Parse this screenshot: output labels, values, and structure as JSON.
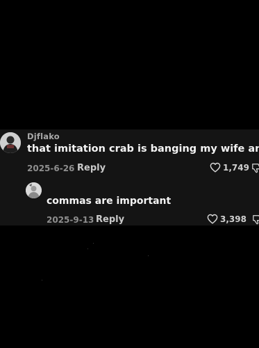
{
  "comment": {
    "username": "Djflako",
    "text": "that imitation crab is banging my wife and I love it",
    "date": "2025-6-26",
    "reply_label": "Reply",
    "likes": "1,749",
    "avatar_icon": "user-avatar-icon"
  },
  "reply": {
    "text": "commas are important",
    "date": "2025-9-13",
    "reply_label": "Reply",
    "likes": "3,398",
    "avatar_icon": "user-avatar-icon"
  },
  "colors": {
    "background": "#000000",
    "panel": "#141414",
    "text_primary": "#f3f3f3",
    "text_secondary": "#8e8e8e"
  },
  "icons": [
    "heart-icon",
    "dislike-icon"
  ]
}
